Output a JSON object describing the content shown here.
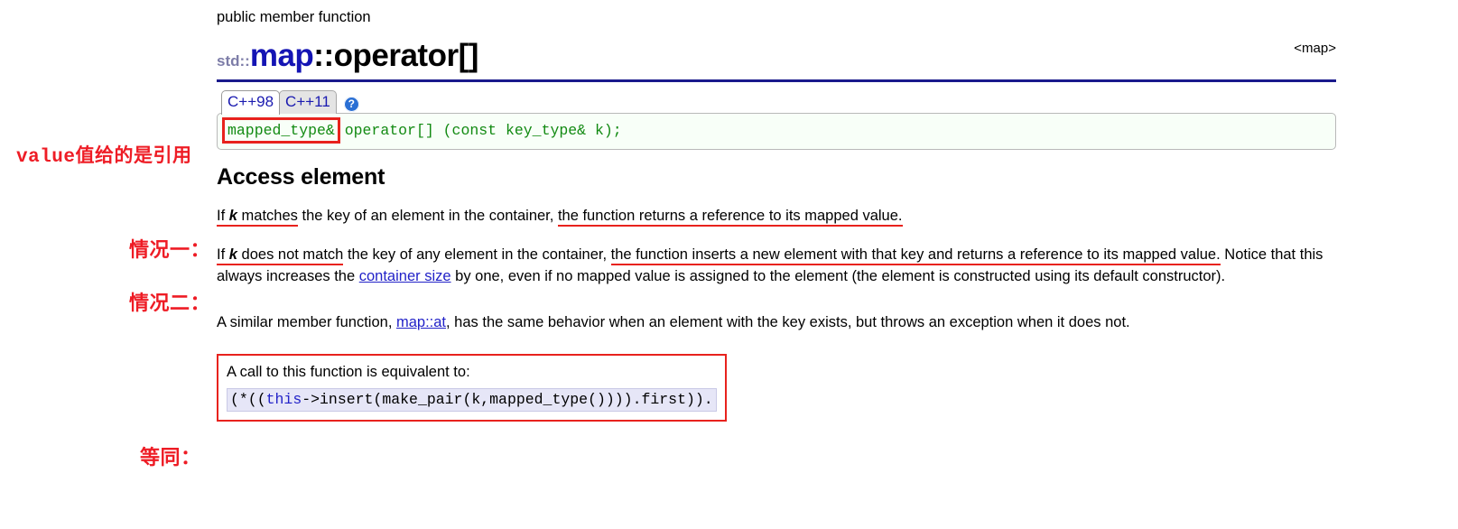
{
  "header": {
    "kicker": "public member function",
    "title_namespace": "std::",
    "title_class": "map",
    "title_rest": "::operator[]",
    "include_header": "<map>"
  },
  "tabs": {
    "items": [
      {
        "label": "C++98",
        "active": true
      },
      {
        "label": "C++11",
        "active": false
      }
    ],
    "help_icon": "?",
    "help_icon_name": "info-help-icon"
  },
  "signature": {
    "highlighted": "mapped_type&",
    "rest": " operator[] (const key_type& k);"
  },
  "section": {
    "heading": "Access element"
  },
  "case1": {
    "annotation": "情况一：",
    "seg_underline_a": "If ",
    "seg_k": "k",
    "seg_underline_b": " matches",
    "seg_plain": " the key of an element in the container, ",
    "seg_underline_c": "the function returns a reference to its mapped value."
  },
  "case2": {
    "annotation": "情况二：",
    "seg_underline_a": "If ",
    "seg_k": "k",
    "seg_underline_b": " does not match",
    "seg_plain_a": " the key of any element in the container, ",
    "seg_underline_c": "the function inserts a new element with that key and returns a reference to its mapped value.",
    "seg_plain_b": " Notice that this always increases the ",
    "link_container_size": "container size",
    "seg_plain_c": " by one, even if no mapped value is assigned to the element (the element is constructed using its default constructor)."
  },
  "similar": {
    "prefix": "A similar member function, ",
    "link": "map::at",
    "suffix": ", has the same behavior when an element with the key exists, but throws an exception when it does not."
  },
  "equivalent": {
    "annotation": "等同：",
    "lead": "A call to this function is equivalent to:",
    "code_pre": "(*((",
    "code_kw": "this",
    "code_post": "->insert(make_pair(k,mapped_type()))).first))."
  },
  "annotations": {
    "value_ref": "value值给的是引用"
  },
  "colors": {
    "annotation_red": "#ee1c25",
    "underline_red": "#e8221d",
    "link_blue": "#2222c8",
    "class_blue": "#1414b4",
    "rule_blue": "#1a1a8c",
    "code_green": "#128a12"
  }
}
